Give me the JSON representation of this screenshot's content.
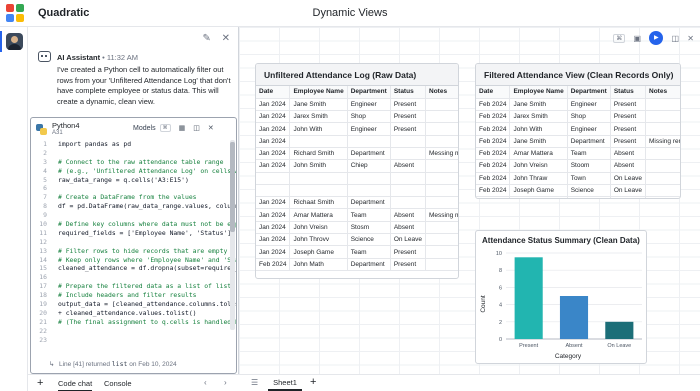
{
  "app": {
    "name": "Quadratic",
    "document_title": "Dynamic Views",
    "logo_colors": [
      "#ea4335",
      "#34a853",
      "#4285f4",
      "#fbbc05"
    ]
  },
  "chat": {
    "assistant_name": "AI Assistant",
    "time": "11:32 AM",
    "message": "I've created a Python cell to automatically filter out rows from your 'Unfiltered Attendance Log' that don't have complete employee or status data. This will create a dynamic, clean view."
  },
  "code_cell": {
    "language": "Python4",
    "location": "A31",
    "models_label": "Models",
    "lines": [
      {
        "n": "1",
        "text": "import pandas as pd",
        "kind": "plain"
      },
      {
        "n": "2",
        "text": "",
        "kind": "plain"
      },
      {
        "n": "3",
        "text": "# Connect to the raw attendance table range",
        "kind": "comment"
      },
      {
        "n": "4",
        "text": "# (e.g., 'Unfiltered Attendance Log' on cells A3:E15)",
        "kind": "comment"
      },
      {
        "n": "5",
        "text": "raw_data_range = q.cells('A3:E15')",
        "kind": "plain"
      },
      {
        "n": "6",
        "text": "",
        "kind": "plain"
      },
      {
        "n": "7",
        "text": "# Create a DataFrame from the values",
        "kind": "comment"
      },
      {
        "n": "8",
        "text": "df = pd.DataFrame(raw_data_range.values, columns=raw",
        "kind": "plain"
      },
      {
        "n": "9",
        "text": "",
        "kind": "plain"
      },
      {
        "n": "10",
        "text": "# Define key columns where data must not be empty",
        "kind": "comment"
      },
      {
        "n": "11",
        "text": "required_fields = ['Employee Name', 'Status']",
        "kind": "plain"
      },
      {
        "n": "12",
        "text": "",
        "kind": "plain"
      },
      {
        "n": "13",
        "text": "# Filter rows to hide records that are empty or inco",
        "kind": "comment"
      },
      {
        "n": "14",
        "text": "# Keep only rows where 'Employee Name' and 'Status'",
        "kind": "comment"
      },
      {
        "n": "15",
        "text": "cleaned_attendance = df.dropna(subset=required_field",
        "kind": "plain"
      },
      {
        "n": "16",
        "text": "",
        "kind": "plain"
      },
      {
        "n": "17",
        "text": "# Prepare the filtered data as a list of lists for g",
        "kind": "comment"
      },
      {
        "n": "18",
        "text": "# Include headers and filter results",
        "kind": "comment"
      },
      {
        "n": "19",
        "text": "output_data = [cleaned_attendance.columns.tolist()]",
        "kind": "plain"
      },
      {
        "n": "20",
        "text": "+ cleaned_attendance.values.tolist()",
        "kind": "plain"
      },
      {
        "n": "21",
        "text": "# (The final assignment to q.cells is handled by the",
        "kind": "comment"
      },
      {
        "n": "22",
        "text": "",
        "kind": "plain"
      },
      {
        "n": "23",
        "text": "",
        "kind": "plain"
      }
    ],
    "footer_prefix": "Line [41] returned",
    "footer_mono": "list",
    "footer_suffix": "on Feb 10, 2024"
  },
  "bottom_left": {
    "tab_code_chat": "Code chat",
    "tab_console": "Console"
  },
  "sheet": {
    "tab_name": "Sheet1"
  },
  "unfiltered_table": {
    "title": "Unfiltered Attendance Log (Raw Data)",
    "headers": [
      "Date",
      "Employee Name",
      "Department",
      "Status",
      "Notes"
    ],
    "rows": [
      [
        "Jan 2024",
        "Jane Smith",
        "Engineer",
        "Present",
        ""
      ],
      [
        "Jan 2024",
        "Jarex Smith",
        "Shop",
        "Present",
        ""
      ],
      [
        "Jan 2024",
        "John With",
        "Engineer",
        "Present",
        ""
      ],
      [
        "Jan 2024",
        "",
        "",
        "",
        ""
      ],
      [
        "Jan 2024",
        "Richard Smith",
        "Department",
        "",
        "Messing mat"
      ],
      [
        "Jan 2024",
        "John Smith",
        "Chiep",
        "Absent",
        ""
      ],
      [
        "",
        "",
        "",
        "",
        ""
      ],
      [
        "",
        "",
        "",
        "",
        ""
      ],
      [
        "Jan 2024",
        "Richaat Smith",
        "Department",
        "",
        ""
      ],
      [
        "Jan 2024",
        "Amar Mattera",
        "Team",
        "Absent",
        "Messing mat"
      ],
      [
        "Jan 2024",
        "John Vreisn",
        "Stosm",
        "Absent",
        ""
      ],
      [
        "Jan 2024",
        "John Throvv",
        "Science",
        "On Leave",
        ""
      ],
      [
        "Jan 2024",
        "Joseph Game",
        "Team",
        "Present",
        ""
      ],
      [
        "Feb 2024",
        "John Math",
        "Department",
        "Present",
        ""
      ]
    ]
  },
  "filtered_table": {
    "title": "Filtered Attendance View (Clean Records Only)",
    "headers": [
      "Date",
      "Employee Name",
      "Department",
      "Status",
      "Notes"
    ],
    "rows": [
      [
        "Feb 2024",
        "Jane Smith",
        "Engineer",
        "Present",
        ""
      ],
      [
        "Feb 2024",
        "Jarex Smith",
        "Shop",
        "Present",
        ""
      ],
      [
        "Feb 2024",
        "John With",
        "Engineer",
        "Present",
        ""
      ],
      [
        "Feb 2024",
        "Jane Smith",
        "Department",
        "Present",
        "Missing rere"
      ],
      [
        "Feb 2024",
        "Amar Mattera",
        "Team",
        "Absent",
        ""
      ],
      [
        "Feb 2024",
        "John Vreisn",
        "Stoom",
        "Absent",
        ""
      ],
      [
        "Feb 2024",
        "John Thraw",
        "Town",
        "On Leave",
        ""
      ],
      [
        "Feb 2024",
        "Joseph Game",
        "Science",
        "On Leave",
        ""
      ],
      [
        "Feb 2024",
        "John Math",
        "Department",
        "Present",
        ""
      ]
    ]
  },
  "chart_data": {
    "type": "bar",
    "title": "Attendance Status Summary (Clean Data)",
    "xlabel": "Category",
    "ylabel": "Count",
    "categories": [
      "Present",
      "Absent",
      "On Leave"
    ],
    "values": [
      9.5,
      5.0,
      2.0
    ],
    "ylim": [
      0,
      10
    ],
    "yticks": [
      0,
      2,
      4,
      6,
      8,
      10
    ],
    "colors": [
      "#22b5b0",
      "#3a86c8",
      "#1c6e78"
    ],
    "grid": true
  }
}
